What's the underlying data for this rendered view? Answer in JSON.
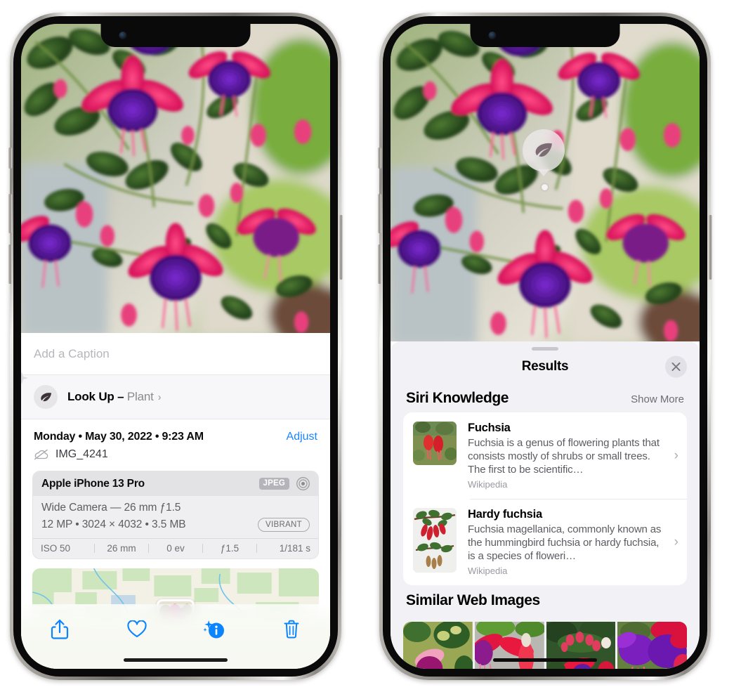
{
  "left_phone": {
    "caption_placeholder": "Add a Caption",
    "lookup": {
      "label": "Look Up – ",
      "subject": "Plant",
      "chevron": "›",
      "icon": "leaf-icon"
    },
    "metadata": {
      "date_line": "Monday • May 30, 2022 • 9:23 AM",
      "adjust_label": "Adjust",
      "filename": "IMG_4241",
      "cloud_icon": "icloud-slash-icon"
    },
    "camera_card": {
      "device": "Apple iPhone 13 Pro",
      "format_badge": "JPEG",
      "lens_icon": "aperture-icon",
      "lens_line": "Wide Camera — 26 mm ƒ1.5",
      "resolution_line": "12 MP • 3024 × 4032 • 3.5 MB",
      "vibrant_badge": "VIBRANT",
      "exif": [
        "ISO 50",
        "26 mm",
        "0 ev",
        "ƒ1.5",
        "1/181 s"
      ]
    },
    "toolbar": [
      {
        "name": "share-button",
        "icon": "share-icon"
      },
      {
        "name": "favorite-button",
        "icon": "heart-icon"
      },
      {
        "name": "info-button",
        "icon": "info-sparkle-icon"
      },
      {
        "name": "delete-button",
        "icon": "trash-icon"
      }
    ]
  },
  "right_phone": {
    "visual_lookup_badge": {
      "icon": "leaf-icon"
    },
    "sheet": {
      "title": "Results",
      "close_icon": "close-icon",
      "siri_knowledge": {
        "heading": "Siri Knowledge",
        "action": "Show More",
        "entries": [
          {
            "title": "Fuchsia",
            "description": "Fuchsia is a genus of flowering plants that consists mostly of shrubs or small trees. The first to be scientific…",
            "source": "Wikipedia",
            "chevron": "›"
          },
          {
            "title": "Hardy fuchsia",
            "description": "Fuchsia magellanica, commonly known as the hummingbird fuchsia or hardy fuchsia, is a species of floweri…",
            "source": "Wikipedia",
            "chevron": "›"
          }
        ]
      },
      "similar_web_images": {
        "heading": "Similar Web Images",
        "count": 4
      }
    }
  },
  "colors": {
    "accent_blue": "#1a84ff",
    "sheet_bg": "#f2f1f6",
    "card_bg": "#ffffff",
    "muted_text": "#8a8a8f"
  }
}
